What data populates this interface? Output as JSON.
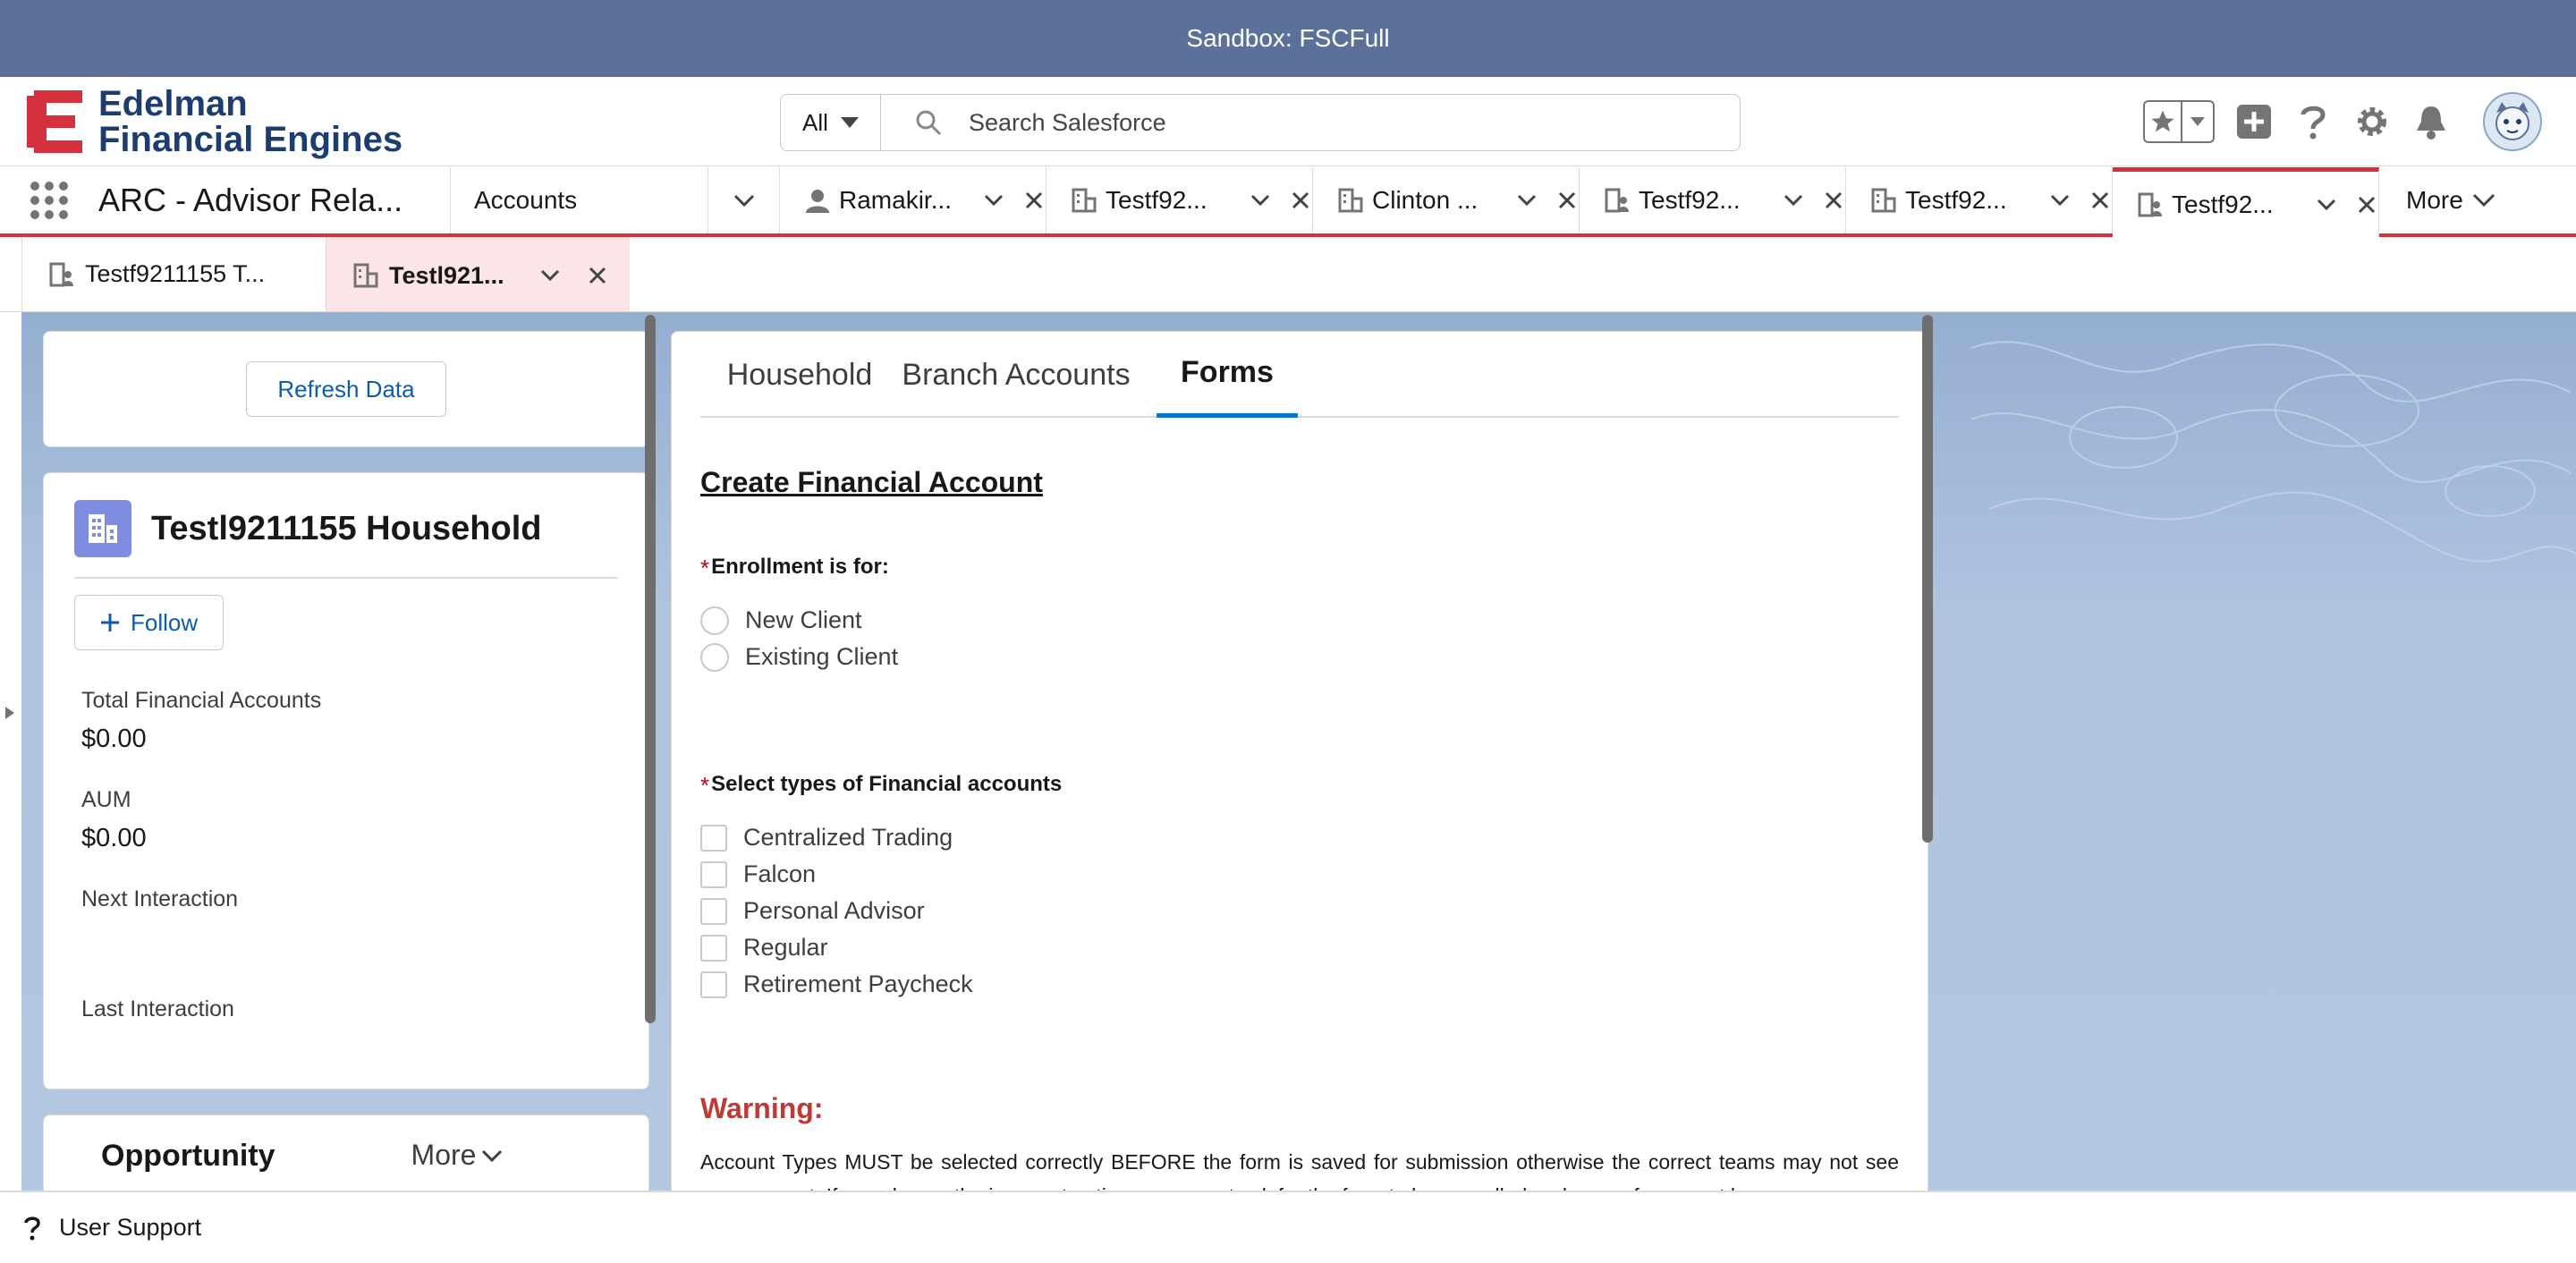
{
  "banner": {
    "text": "Sandbox: FSCFull"
  },
  "brand": {
    "line1": "Edelman",
    "line2": "Financial Engines"
  },
  "search": {
    "scope": "All",
    "placeholder": "Search Salesforce"
  },
  "header_icons": [
    "favorites-star-icon",
    "add-icon",
    "help-icon",
    "setup-gear-icon",
    "notifications-bell-icon",
    "user-avatar"
  ],
  "nav": {
    "app_name": "ARC - Advisor Rela...",
    "accounts_label": "Accounts",
    "tabs": [
      {
        "label": "Ramakir...",
        "icon": "person-icon"
      },
      {
        "label": "Testf92...",
        "icon": "household-icon"
      },
      {
        "label": "Clinton ...",
        "icon": "household-icon"
      },
      {
        "label": "Testf92...",
        "icon": "person-account-icon"
      },
      {
        "label": "Testf92...",
        "icon": "household-icon"
      },
      {
        "label": "Testf92...",
        "icon": "person-account-icon",
        "active": true
      }
    ],
    "more_label": "More"
  },
  "subtabs": [
    {
      "label": "Testf9211155 T..."
    },
    {
      "label": "Testl921...",
      "active": true
    }
  ],
  "left": {
    "refresh_label": "Refresh Data",
    "household_name": "Testl9211155 Household",
    "follow_label": "Follow",
    "fields": [
      {
        "label": "Total Financial Accounts",
        "value": "$0.00"
      },
      {
        "label": "AUM",
        "value": "$0.00"
      },
      {
        "label": "Next Interaction",
        "value": ""
      },
      {
        "label": "Last Interaction",
        "value": ""
      }
    ],
    "opportunity": {
      "title": "Opportunity",
      "more_label": "More"
    }
  },
  "main": {
    "tabs": [
      "Household",
      "Branch Accounts",
      "Forms"
    ],
    "active_tab": "Forms",
    "form": {
      "title": "Create Financial Account",
      "enrollment_label": "Enrollment is for:",
      "enrollment_options": [
        "New Client",
        "Existing Client"
      ],
      "types_label": "Select types of Financial accounts",
      "type_options": [
        "Centralized Trading",
        "Falcon",
        "Personal Advisor",
        "Regular",
        "Retirement Paycheck"
      ],
      "warning_title": "Warning:",
      "warning_text": "Account Types MUST be selected correctly BEFORE the form is saved for submission otherwise the correct teams may not see your request. If you choose the incorrect options, you must ask for the form to be cancelled and a new form must be"
    }
  },
  "utility": {
    "label": "User Support"
  },
  "colors": {
    "banner": "#5b7199",
    "active_tab_accent": "#d4303e",
    "link_blue": "#0b5cab",
    "warning_red": "#c23934",
    "workspace_bg": "#b0c4df"
  }
}
